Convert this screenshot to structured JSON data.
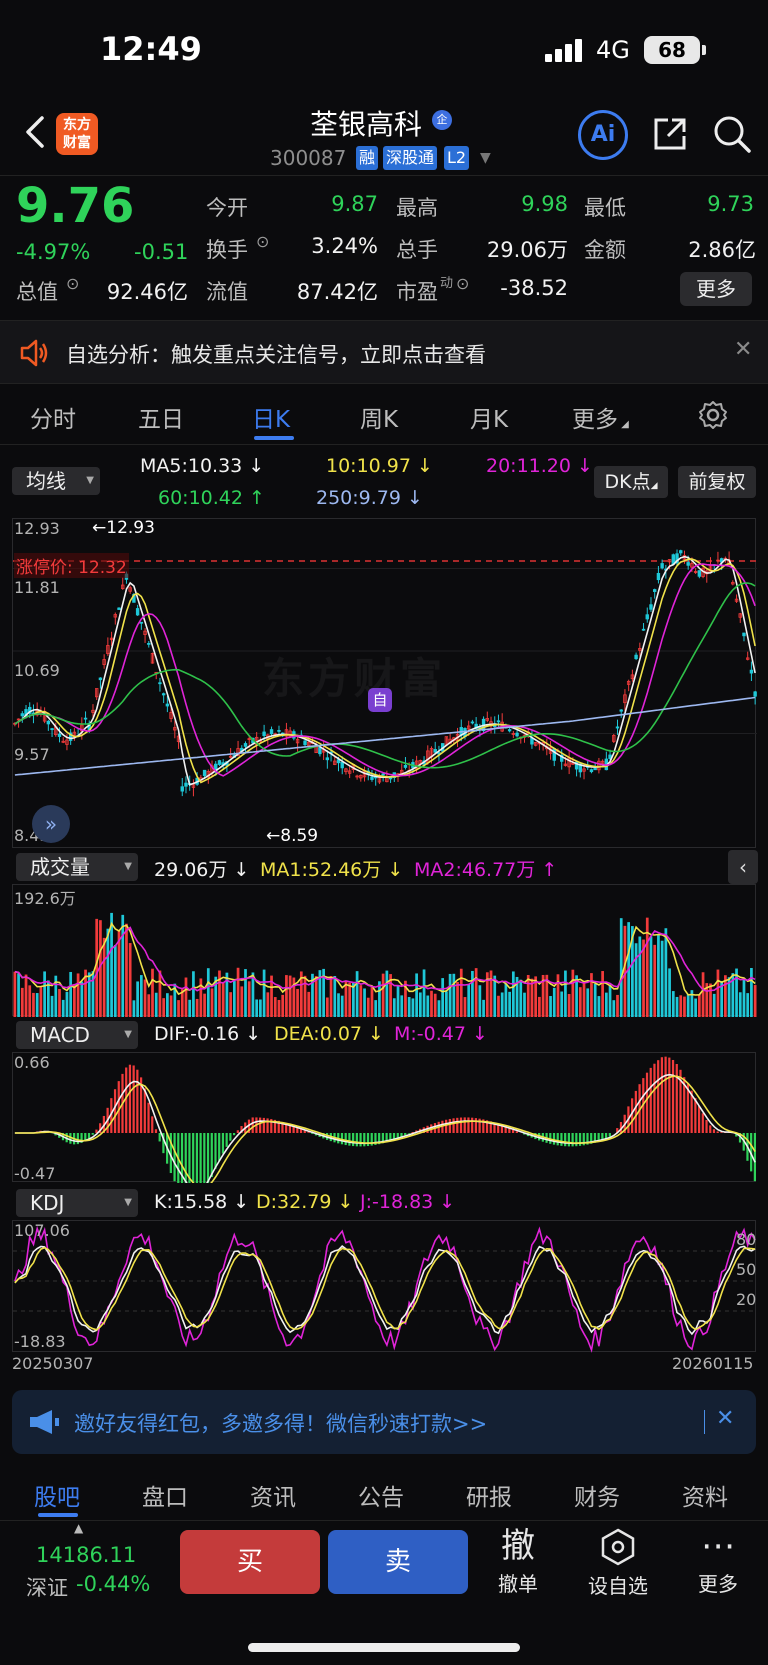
{
  "status_bar": {
    "time": "12:49",
    "network": "4G",
    "battery": "68"
  },
  "header": {
    "logo_text": "东方财富",
    "stock_name": "荃银高科",
    "co_badge": "企",
    "code": "300087",
    "tags": [
      "融",
      "深股通",
      "L2"
    ],
    "ai_label": "Ai"
  },
  "quote": {
    "price": "9.76",
    "pct": "-4.97%",
    "change": "-0.51",
    "open_label": "今开",
    "open": "9.87",
    "high_label": "最高",
    "high": "9.98",
    "low_label": "最低",
    "low": "9.73",
    "turnover_label": "换手",
    "turnover": "3.24%",
    "volume_label": "总手",
    "volume": "29.06万",
    "amount_label": "金额",
    "amount": "2.86亿",
    "mktcap_label": "总值",
    "mktcap": "92.46亿",
    "float_label": "流值",
    "float": "87.42亿",
    "pe_label": "市盈",
    "pe_sup": "动",
    "pe": "-38.52",
    "more": "更多"
  },
  "alert": {
    "text": "自选分析：触发重点关注信号，立即点击查看"
  },
  "period_tabs": [
    "分时",
    "五日",
    "日K",
    "周K",
    "月K",
    "更多"
  ],
  "active_period": "日K",
  "ma_row": {
    "selector": "均线",
    "ma5": "MA5:10.33",
    "ma10": "10:10.97",
    "ma20": "20:11.20",
    "ma60": "60:10.42",
    "ma250": "250:9.79",
    "dk_btn": "DK点",
    "fq_btn": "前复权"
  },
  "kline": {
    "y_high": "12.93",
    "y_2": "11.81",
    "y_3": "10.69",
    "y_4": "9.57",
    "y_low": "8.45",
    "max_label": "12.93",
    "min_label": "8.59",
    "limit_label": "涨停价: 12.32",
    "watermark": "东方财富",
    "self_marker": "自"
  },
  "volume": {
    "selector": "成交量",
    "vol": "29.06万",
    "ma1": "MA1:52.46万",
    "ma2": "MA2:46.77万",
    "y_max": "192.6万"
  },
  "macd": {
    "selector": "MACD",
    "dif": "DIF:-0.16",
    "dea": "DEA:0.07",
    "m": "M:-0.47",
    "y_max": "0.66",
    "y_min": "-0.47"
  },
  "kdj": {
    "selector": "KDJ",
    "k": "K:15.58",
    "d": "D:32.79",
    "j": "J:-18.83",
    "y_max": "107.06",
    "y_min": "-18.83",
    "r80": "80",
    "r50": "50",
    "r20": "20"
  },
  "dates": {
    "start": "20250307",
    "end": "20260115"
  },
  "invite": {
    "text": "邀好友得红包，多邀多得！微信秒速打款>>"
  },
  "bottom_tabs": [
    "股吧",
    "盘口",
    "资讯",
    "公告",
    "研报",
    "财务",
    "资料"
  ],
  "index": {
    "value": "14186.11",
    "name": "深证",
    "change": "-0.44%"
  },
  "actions": {
    "buy": "买",
    "sell": "卖",
    "cancel_big": "撤",
    "cancel": "撤单",
    "watch": "设自选",
    "more": "更多"
  },
  "colors": {
    "up": "#f23b3b",
    "down": "#2fd35a",
    "accent": "#3d7cf0",
    "ma5": "#f2f2f2",
    "ma10": "#f0e24a",
    "ma20": "#e024d8",
    "ma60": "#2fc14a",
    "ma250": "#9db8f0"
  }
}
